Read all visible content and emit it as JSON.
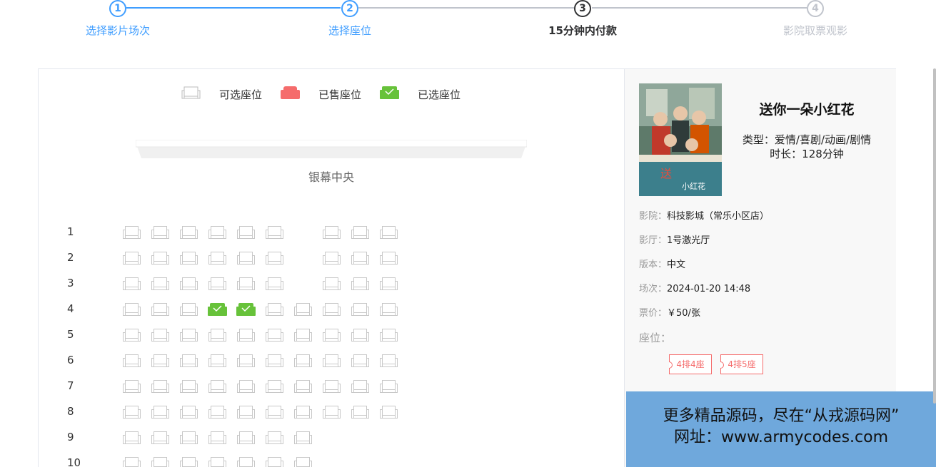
{
  "steps": [
    {
      "num": "1",
      "label": "选择影片场次",
      "state": "done"
    },
    {
      "num": "2",
      "label": "选择座位",
      "state": "done"
    },
    {
      "num": "3",
      "label": "15分钟内付款",
      "state": "current"
    },
    {
      "num": "4",
      "label": "影院取票观影",
      "state": "wait"
    }
  ],
  "legend": {
    "available": "可选座位",
    "sold": "已售座位",
    "selected": "已选座位"
  },
  "screen_label": "银幕中央",
  "rows": [
    "1",
    "2",
    "3",
    "4",
    "5",
    "6",
    "7",
    "8",
    "9",
    "10"
  ],
  "seat_map": [
    [
      "a",
      "a",
      "a",
      "a",
      "a",
      "a",
      "_",
      "a",
      "a",
      "a"
    ],
    [
      "a",
      "a",
      "a",
      "a",
      "a",
      "a",
      "_",
      "a",
      "a",
      "a"
    ],
    [
      "a",
      "a",
      "a",
      "a",
      "a",
      "a",
      "_",
      "a",
      "a",
      "a"
    ],
    [
      "a",
      "a",
      "a",
      "s",
      "s",
      "a",
      "a",
      "a",
      "a",
      "a"
    ],
    [
      "a",
      "a",
      "a",
      "a",
      "a",
      "a",
      "a",
      "a",
      "a",
      "a"
    ],
    [
      "a",
      "a",
      "a",
      "a",
      "a",
      "a",
      "a",
      "a",
      "a",
      "a"
    ],
    [
      "a",
      "a",
      "a",
      "a",
      "a",
      "a",
      "a",
      "a",
      "a",
      "a"
    ],
    [
      "a",
      "a",
      "a",
      "a",
      "a",
      "a",
      "a",
      "a",
      "a",
      "a"
    ],
    [
      "a",
      "a",
      "a",
      "a",
      "a",
      "a",
      "a",
      "_",
      "_",
      "_"
    ],
    [
      "a",
      "a",
      "a",
      "a",
      "a",
      "a",
      "a",
      "_",
      "_",
      "_"
    ]
  ],
  "movie": {
    "title": "送你一朵小红花",
    "genre": "类型：爱情/喜剧/动画/剧情",
    "duration": "时长：128分钟",
    "poster_icon": "movie-poster"
  },
  "details": {
    "cinema_key": "影院：",
    "cinema": "科技影城（常乐小区店）",
    "hall_key": "影厅：",
    "hall": "1号激光厅",
    "version_key": "版本：",
    "version": "中文",
    "session_key": "场次：",
    "session": "2024-01-20 14:48",
    "price_key": "票价：",
    "price": "￥50/张",
    "seats_key": "座位："
  },
  "tickets": [
    "4排4座",
    "4排5座"
  ],
  "banner": {
    "line1": "更多精品源码，尽在“从戎源码网”",
    "line2": "网址：www.armycodes.com"
  },
  "colors": {
    "primary": "#409eff",
    "sold": "#f56c6c",
    "selected": "#67c23a",
    "banner": "#6fa8dc"
  }
}
